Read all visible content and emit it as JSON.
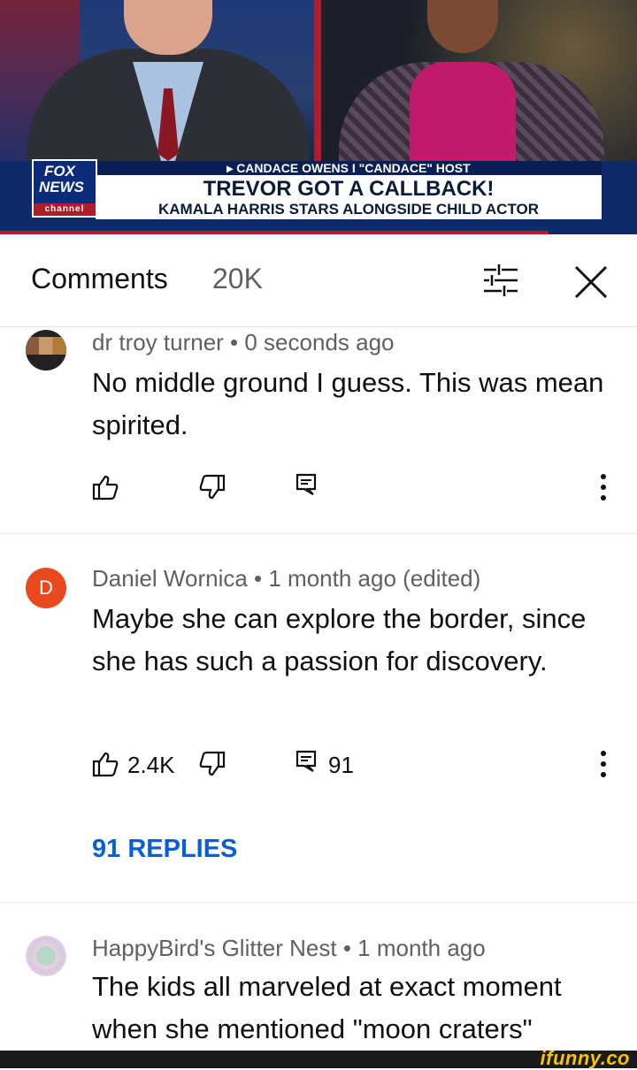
{
  "video": {
    "channel_logo": {
      "line1": "FOX",
      "line2": "NEWS",
      "line3": "channel"
    },
    "banner_top": "▸ CANDACE OWENS I \"CANDACE\" HOST",
    "headline": "TREVOR GOT A CALLBACK!",
    "subheadline": "KAMALA HARRIS STARS ALONGSIDE CHILD ACTOR",
    "colors": {
      "fox_blue": "#0c2a7a",
      "fox_red": "#c8102e"
    }
  },
  "comments_panel": {
    "title": "Comments",
    "count": "20K",
    "icons": {
      "filter": "sort-filter-icon",
      "close": "close-icon"
    }
  },
  "comments": [
    {
      "author": "dr troy turner",
      "time": "0 seconds ago",
      "meta": "dr troy turner • 0 seconds ago",
      "text": "No middle ground I guess. This was mean spirited.",
      "likes": "",
      "replies_count": "",
      "replies_link": ""
    },
    {
      "author": "Daniel Wornica",
      "avatar_letter": "D",
      "avatar_color": "#e8491d",
      "meta": "Daniel Wornica • 1 month ago (edited)",
      "text": "Maybe she can explore the border, since she has such a passion for discovery.",
      "likes": "2.4K",
      "replies_count": "91",
      "replies_link": "91 REPLIES"
    },
    {
      "author": "HappyBird's Glitter Nest",
      "meta": "HappyBird's Glitter Nest • 1 month ago",
      "text": "The kids all marveled at exact moment when she mentioned \"moon craters\""
    }
  ],
  "watermark": "ifunny.co",
  "link_color": "#065fd4"
}
